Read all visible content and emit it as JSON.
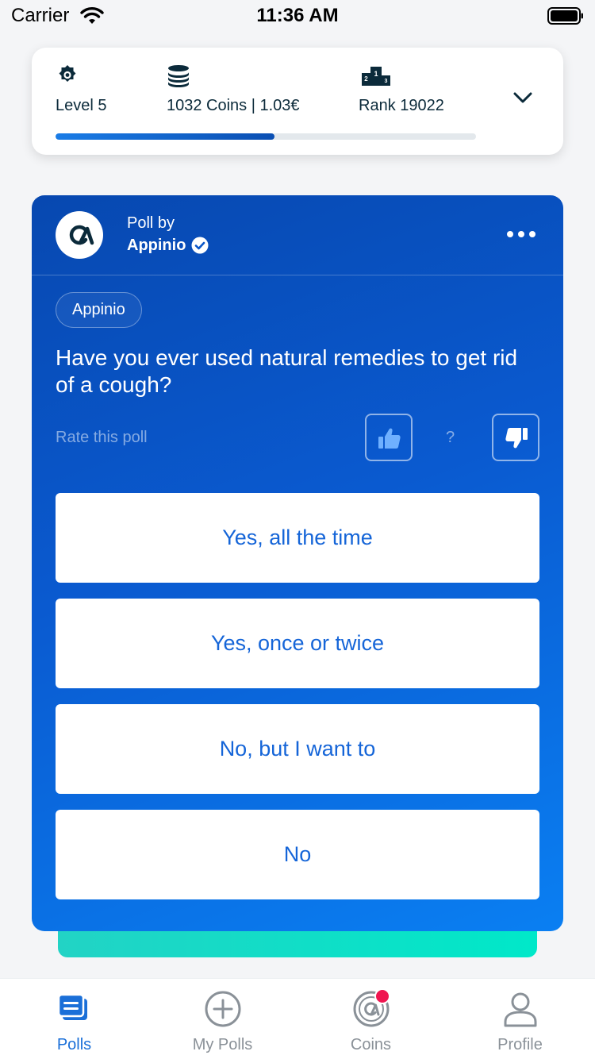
{
  "status_bar": {
    "carrier": "Carrier",
    "time": "11:36 AM"
  },
  "stats": {
    "level": "Level 5",
    "coins": "1032 Coins | 1.03€",
    "rank": "Rank 19022",
    "progress": 0.52
  },
  "poll": {
    "poll_by_label": "Poll by",
    "author": "Appinio",
    "tag": "Appinio",
    "question": "Have you ever used natural remedies to get rid of a cough?",
    "rate_label": "Rate this poll",
    "rating_value": "?",
    "answers": [
      "Yes, all the time",
      "Yes, once or twice",
      "No, but I want to",
      "No"
    ]
  },
  "tabs": {
    "polls": "Polls",
    "my_polls": "My Polls",
    "coins": "Coins",
    "profile": "Profile"
  },
  "colors": {
    "accent": "#1a6fd8",
    "card_gradient_start": "#0748b0",
    "card_gradient_end": "#0a7ff2",
    "teal": "#00e8c9",
    "notification": "#ef1550"
  },
  "icons": {
    "level": "gear-badge-icon",
    "coins": "coin-stack-icon",
    "rank": "podium-icon",
    "expand": "chevron-down-icon",
    "verified": "verified-check-icon",
    "more": "more-dots-icon",
    "thumb_up": "thumbs-up-icon",
    "thumb_down": "thumbs-down-icon"
  }
}
